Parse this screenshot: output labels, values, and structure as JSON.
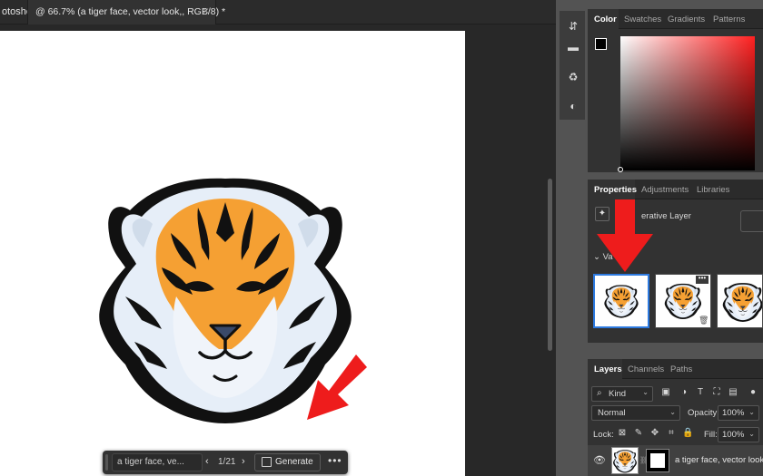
{
  "app": {
    "name": "otoshop"
  },
  "document_tab": {
    "title": "@ 66.7% (a tiger face, vector look,, RGB/8) *",
    "close": "×"
  },
  "taskbar": {
    "prompt_value": "a tiger face, ve...",
    "prev": "‹",
    "variation_counter": "1/21",
    "next": "›",
    "generate_label": "Generate",
    "more": "•••"
  },
  "color_panel": {
    "tabs": [
      "Color",
      "Swatches",
      "Gradients",
      "Patterns"
    ],
    "active_tab": "Color",
    "foreground": "#000000",
    "background": "#ffffff",
    "hue_color": "#ff2020"
  },
  "properties_panel": {
    "tabs": [
      "Properties",
      "Adjustments",
      "Libraries"
    ],
    "active_tab": "Properties",
    "layer_kind": "erative Layer",
    "variations_label": "Va",
    "thumbnails": [
      {
        "name": "variation-1",
        "selected": true
      },
      {
        "name": "variation-2",
        "selected": false,
        "more": "•••"
      },
      {
        "name": "variation-3",
        "selected": false
      }
    ]
  },
  "layers_panel": {
    "tabs": [
      "Layers",
      "Channels",
      "Paths"
    ],
    "active_tab": "Layers",
    "filter_label": "Kind",
    "blend_mode": "Normal",
    "opacity_label": "Opacity:",
    "opacity_value": "100%",
    "lock_label": "Lock:",
    "fill_label": "Fill:",
    "fill_value": "100%",
    "layer": {
      "name": "a tiger face, vector look,",
      "visible": true
    }
  },
  "colors": {
    "accent_selection": "#2d7ae0",
    "annotation_arrow": "#ee1c1c",
    "tiger_orange": "#f5a033",
    "tiger_white": "#e6eef8"
  }
}
